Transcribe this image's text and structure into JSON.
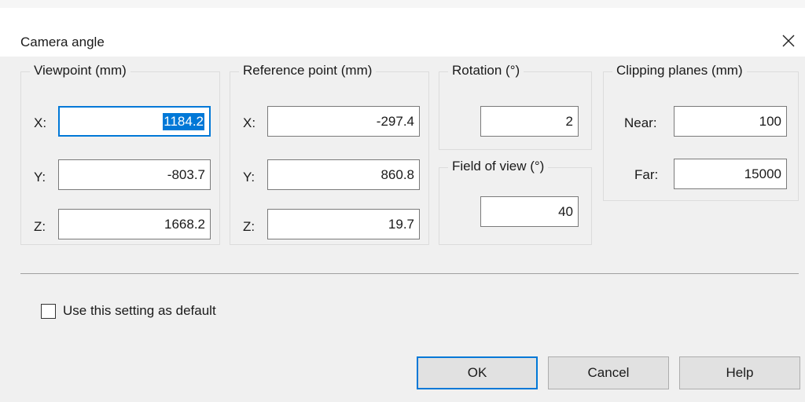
{
  "dialog": {
    "title": "Camera angle"
  },
  "viewpoint": {
    "legend": "Viewpoint (mm)",
    "x_label": "X:",
    "x_value": "1184.2",
    "y_label": "Y:",
    "y_value": "-803.7",
    "z_label": "Z:",
    "z_value": "1668.2"
  },
  "reference": {
    "legend": "Reference point (mm)",
    "x_label": "X:",
    "x_value": "-297.4",
    "y_label": "Y:",
    "y_value": "860.8",
    "z_label": "Z:",
    "z_value": "19.7"
  },
  "rotation": {
    "legend": "Rotation (°)",
    "value": "2"
  },
  "fov": {
    "legend": "Field of view (°)",
    "value": "40"
  },
  "clipping": {
    "legend": "Clipping planes (mm)",
    "near_label": "Near:",
    "near_value": "100",
    "far_label": "Far:",
    "far_value": "15000"
  },
  "default_checkbox": {
    "label": "Use this setting as default",
    "checked": false
  },
  "buttons": {
    "ok": "OK",
    "cancel": "Cancel",
    "help": "Help"
  },
  "icons": {
    "close": "close-icon"
  },
  "colors": {
    "accent": "#0078d7",
    "dialog_bg": "#f0f0f0"
  }
}
